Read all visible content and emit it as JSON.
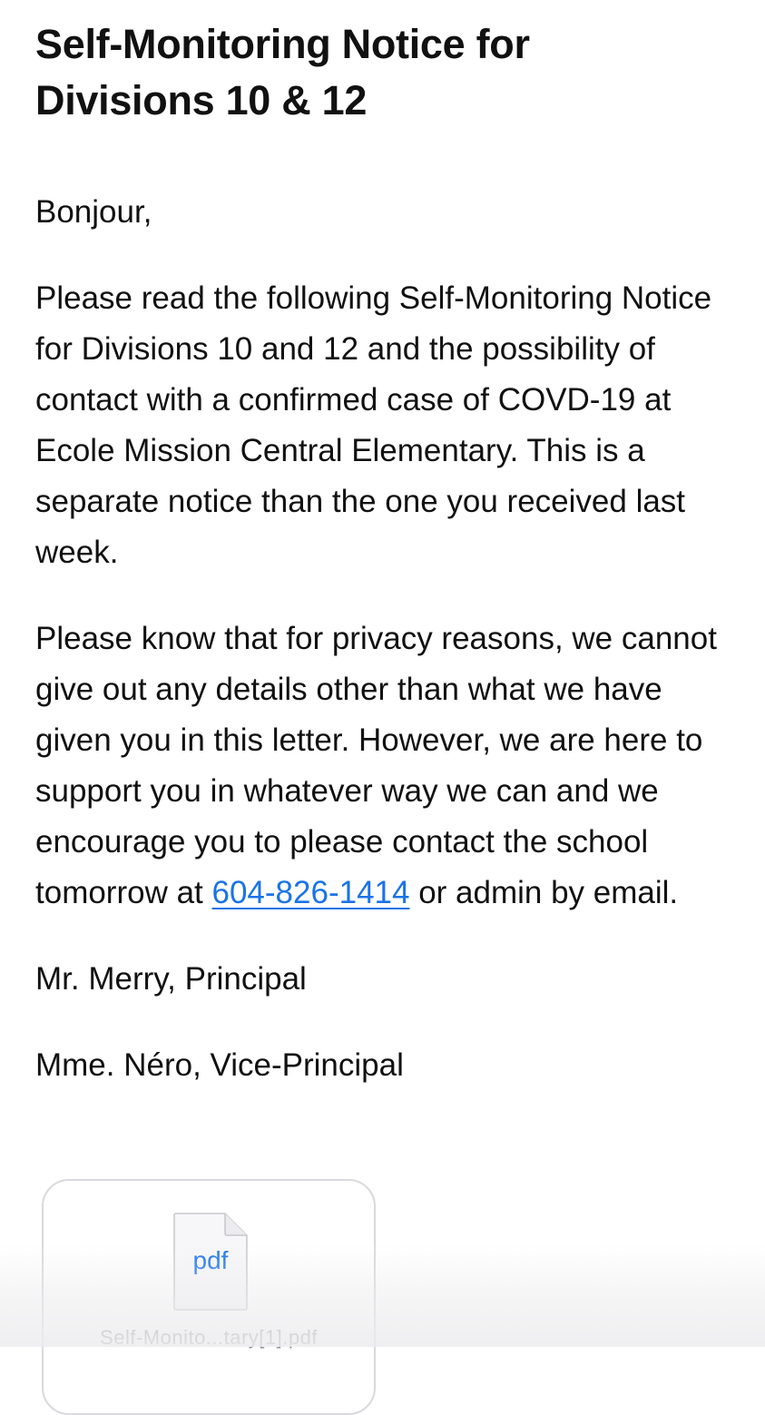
{
  "email": {
    "subject_line1": "Self-Monitoring Notice for",
    "subject_line2": "Divisions 10 & 12",
    "greeting": "Bonjour,",
    "paragraph1": "Please read the following Self-Monitoring Notice for Divisions 10 and 12 and the possibility of contact with a confirmed case of COVD-19 at Ecole Mission Central Elementary. This is a separate notice than the one you received last week.",
    "paragraph2_before": "Please know that for privacy reasons, we cannot give out any details other than what we have given you in this letter. However, we are here to support you in whatever way we can and we encourage you to please contact the school tomorrow at ",
    "phone": "604-826-1414",
    "paragraph2_after": " or admin by email.",
    "signature_principal": "Mr. Merry, Principal",
    "signature_vice_principal": "Mme. Néro, Vice-Principal"
  },
  "attachment": {
    "icon": "pdf-file-icon",
    "extension": "pdf",
    "filename": "Self-Monito...tary[1].pdf"
  },
  "colors": {
    "link": "#1a73e8",
    "text": "#111111",
    "card_border": "#d9d9de"
  }
}
